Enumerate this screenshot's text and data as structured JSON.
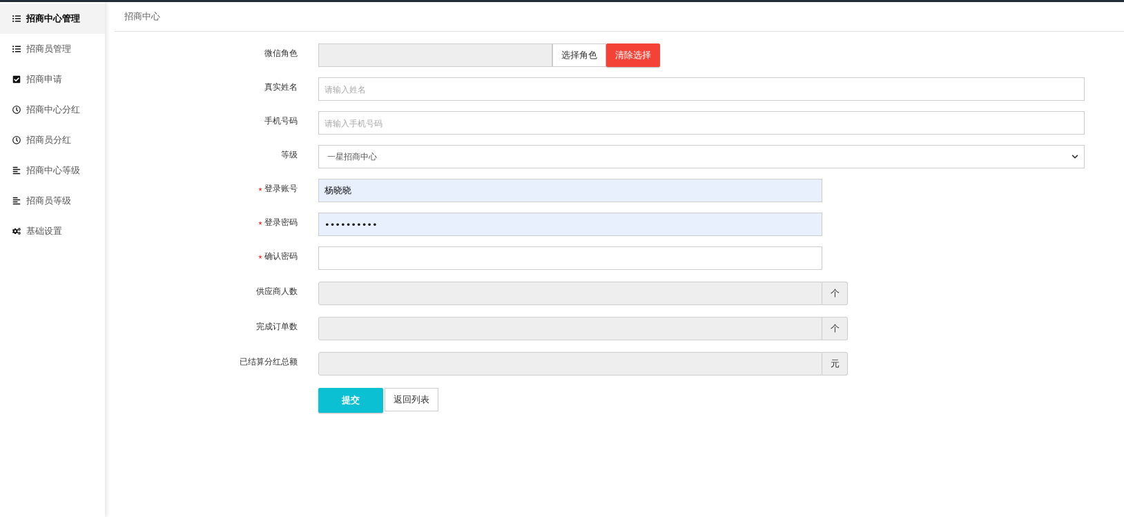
{
  "sidebar": {
    "items": [
      {
        "label": "招商中心管理",
        "kind": "list",
        "selected": true
      },
      {
        "label": "招商员管理",
        "kind": "list",
        "selected": false
      },
      {
        "label": "招商申请",
        "kind": "check",
        "selected": false
      },
      {
        "label": "招商中心分红",
        "kind": "clock",
        "selected": false
      },
      {
        "label": "招商员分红",
        "kind": "clock",
        "selected": false
      },
      {
        "label": "招商中心等级",
        "kind": "lines",
        "selected": false
      },
      {
        "label": "招商员等级",
        "kind": "lines",
        "selected": false
      },
      {
        "label": "基础设置",
        "kind": "gears",
        "selected": false
      }
    ]
  },
  "header": {
    "title": "招商中心"
  },
  "form": {
    "fields": [
      {
        "kind": "role",
        "label": "微信角色",
        "required": false,
        "disabled": true,
        "buttons": [
          {
            "label": "选择角色",
            "kind": "default"
          },
          {
            "label": "清除选择",
            "kind": "danger"
          }
        ]
      },
      {
        "kind": "text",
        "label": "真实姓名",
        "required": false,
        "wide": true,
        "autofilled": false,
        "placeholder": "请输入姓名"
      },
      {
        "kind": "text",
        "label": "手机号码",
        "required": false,
        "wide": true,
        "autofilled": false,
        "placeholder": "请输入手机号码"
      },
      {
        "kind": "select",
        "label": "等级",
        "required": false,
        "value": "一星招商中心"
      },
      {
        "kind": "text",
        "label": "登录账号",
        "required": true,
        "wide": false,
        "autofilled": true,
        "value": "杨晓晓"
      },
      {
        "kind": "text",
        "label": "登录密码",
        "required": true,
        "wide": false,
        "autofilled": true,
        "value": "••••••••••"
      },
      {
        "kind": "text",
        "label": "确认密码",
        "required": true,
        "wide": false,
        "autofilled": false
      },
      {
        "kind": "addon",
        "label": "供应商人数",
        "required": false,
        "disabled": true,
        "unit": "个"
      },
      {
        "kind": "addon",
        "label": "完成订单数",
        "required": false,
        "disabled": true,
        "unit": "个"
      },
      {
        "kind": "addon",
        "label": "已结算分红总额",
        "required": false,
        "disabled": true,
        "unit": "元"
      }
    ],
    "actions": [
      {
        "label": "提交",
        "kind": "primary"
      },
      {
        "label": "返回列表",
        "kind": "default"
      }
    ]
  }
}
